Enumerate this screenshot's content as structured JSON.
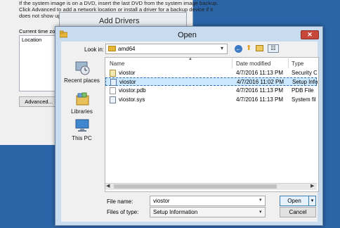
{
  "background_dialog": {
    "instructions": "If the system image is on a DVD, insert the last DVD from the system image backup. Click Advanced to add a network location or install a driver for a backup device if it does not show up in the list be",
    "time_zone_label": "Current time zo",
    "list_header": "Location",
    "advanced_button": "Advanced..."
  },
  "add_drivers": {
    "title": "Add Drivers"
  },
  "open_dialog": {
    "title": "Open",
    "close_glyph": "✕",
    "look_in_label": "Look in:",
    "look_in_value": "amd64",
    "nav": [
      {
        "label": "Recent places",
        "icon": "recent-places-icon"
      },
      {
        "label": "Libraries",
        "icon": "libraries-icon"
      },
      {
        "label": "This PC",
        "icon": "this-pc-icon"
      }
    ],
    "columns": {
      "name": "Name",
      "date": "Date modified",
      "type": "Type"
    },
    "files": [
      {
        "name": "viostor",
        "date": "4/7/2016 11:13 PM",
        "type": "Security C",
        "icon": "security-catalog-icon",
        "selected": false
      },
      {
        "name": "viostor",
        "date": "4/7/2016 11:02 PM",
        "type": "Setup Info",
        "icon": "setup-information-icon",
        "selected": true
      },
      {
        "name": "viostor.pdb",
        "date": "4/7/2016 11:13 PM",
        "type": "PDB File",
        "icon": "pdb-file-icon",
        "selected": false
      },
      {
        "name": "viostor.sys",
        "date": "4/7/2016 11:13 PM",
        "type": "System fil",
        "icon": "system-file-icon",
        "selected": false
      }
    ],
    "file_name_label": "File name:",
    "file_name_value": "viostor",
    "files_of_type_label": "Files of type:",
    "files_of_type_value": "Setup Information",
    "open_button": "Open",
    "cancel_button": "Cancel"
  }
}
